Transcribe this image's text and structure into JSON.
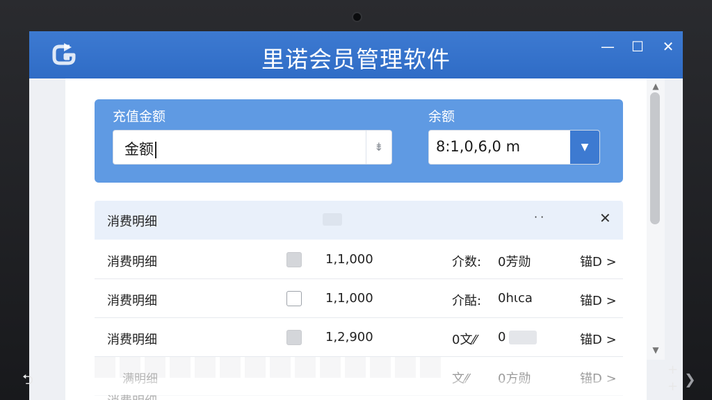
{
  "window": {
    "title": "里诺会员管理软件",
    "minimize": "—",
    "maximize": "☐",
    "close": "✕"
  },
  "form": {
    "amount_label": "充值金额",
    "amount_value": "金额",
    "balance_label": "余额",
    "balance_value": "8:1,0,6,0 m",
    "dropdown_arrow": "▼",
    "amount_icon": "⇟"
  },
  "table": {
    "header_title": "消费明细",
    "header_more": "··",
    "header_close": "✕",
    "rows": [
      {
        "name": "消费明细",
        "checked": true,
        "amount": "1,1,000",
        "type": "介数:",
        "value": "0芳勋",
        "link": "锚D >"
      },
      {
        "name": "消费明细",
        "checked": false,
        "amount": "1,1,000",
        "type": "介酤:",
        "value": "0hιca",
        "link": "锚D >"
      },
      {
        "name": "消费明细",
        "checked": true,
        "amount": "1,2,900",
        "type": "0文⁄⁄",
        "value": "0",
        "link": "锚D >"
      }
    ],
    "faded_rows": [
      {
        "name": "满明细",
        "type": "文⁄⁄",
        "value": "0方勋",
        "link": "锚D >"
      },
      {
        "name": "消费明细"
      }
    ]
  },
  "scroll": {
    "up": "▲",
    "down": "▼"
  },
  "device": {
    "rotate_icon": "⮌",
    "plus": "+",
    "chevron": "❯"
  },
  "colors": {
    "titlebar": "#3d7ad1",
    "panel": "#5f9ae3",
    "accent": "#3d7ad1"
  }
}
